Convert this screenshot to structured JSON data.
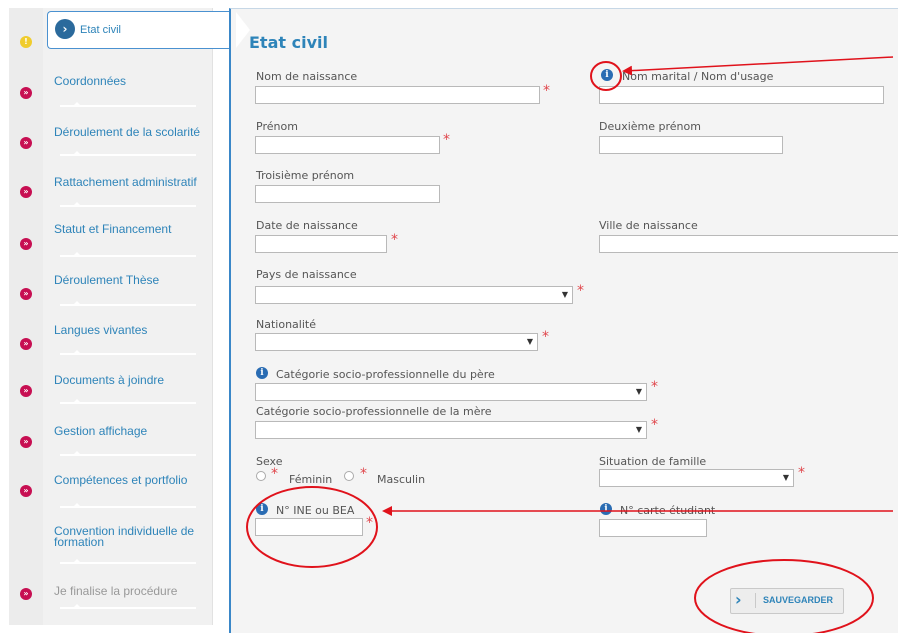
{
  "sidebar": {
    "active_label": "Etat civil",
    "items": [
      {
        "label": "Coordonnées"
      },
      {
        "label": "Déroulement de la scolarité"
      },
      {
        "label": "Rattachement administratif"
      },
      {
        "label": "Statut et Financement"
      },
      {
        "label": "Déroulement Thèse"
      },
      {
        "label": "Langues vivantes"
      },
      {
        "label": "Documents à joindre"
      },
      {
        "label": "Gestion affichage"
      },
      {
        "label": "Compétences et portfolio"
      },
      {
        "label": "Convention individuelle de formation"
      },
      {
        "label": "Je finalise la procédure"
      }
    ]
  },
  "form": {
    "title": "Etat civil",
    "nom_naissance": "Nom de naissance",
    "nom_marital": "Nom marital / Nom d'usage",
    "prenom": "Prénom",
    "deuxieme_prenom": "Deuxième prénom",
    "troisieme_prenom": "Troisième prénom",
    "date_naissance": "Date de naissance",
    "ville_naissance": "Ville de naissance",
    "pays_naissance": "Pays de naissance",
    "nationalite": "Nationalité",
    "csp_pere": "Catégorie socio-professionnelle du père",
    "csp_mere": "Catégorie socio-professionnelle de la mère",
    "sexe": "Sexe",
    "feminin": "Féminin",
    "masculin": "Masculin",
    "situation_famille": "Situation de famille",
    "ine": "N° INE ou BEA",
    "carte_etudiant": "N° carte étudiant",
    "save_label": "SAUVEGARDER"
  },
  "icons": {
    "info": "i",
    "bullet": "»",
    "warn": "!",
    "chevron": "›"
  },
  "colors": {
    "accent": "#2e84b9",
    "bullet": "#c70f52",
    "warn": "#f0cc2c",
    "required": "#e0464b",
    "annotation": "#e0121b"
  }
}
